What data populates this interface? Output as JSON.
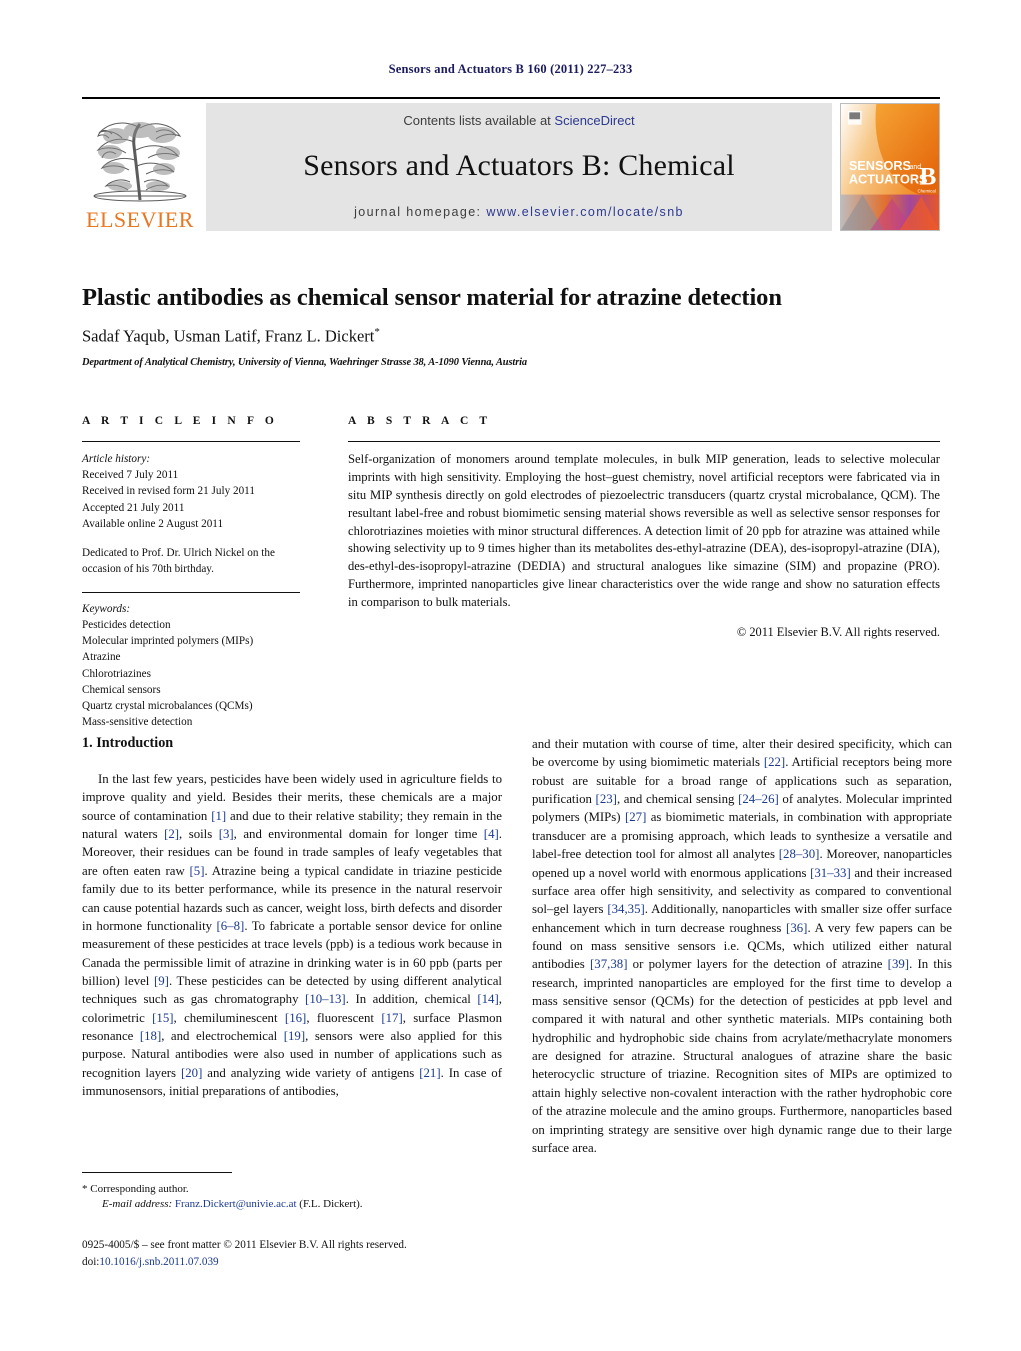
{
  "running_head": "Sensors and Actuators B 160 (2011) 227–233",
  "masthead": {
    "contents_prefix": "Contents lists available at ",
    "sciencedirect": "ScienceDirect",
    "journal_title": "Sensors and Actuators B: Chemical",
    "homepage_prefix": "journal homepage: ",
    "homepage_url": "www.elsevier.com/locate/snb",
    "publisher_wordmark": "ELSEVIER",
    "publisher_logo_icon": "elsevier-tree-icon",
    "cover": {
      "line1": "SENSORS",
      "line1_small": "and",
      "line2": "ACTUATORS",
      "letter": "B",
      "letter_sub": "Chemical"
    },
    "accent_orange": "#E87722",
    "link_blue": "#2b3990",
    "band_gray": "#e4e4e4"
  },
  "article": {
    "title": "Plastic antibodies as chemical sensor material for atrazine detection",
    "authors": "Sadaf Yaqub, Usman Latif, Franz L. Dickert",
    "corresponding_marker": "*",
    "affiliation": "Department of Analytical Chemistry, University of Vienna, Waehringer Strasse 38, A-1090 Vienna, Austria"
  },
  "article_info": {
    "heading": "A R T I C L E  I N F O",
    "history_label": "Article history:",
    "history": [
      "Received 7 July 2011",
      "Received in revised form 21 July 2011",
      "Accepted 21 July 2011",
      "Available online 2 August 2011"
    ],
    "dedication": "Dedicated to Prof. Dr. Ulrich Nickel on the occasion of his 70th birthday.",
    "keywords_label": "Keywords:",
    "keywords": [
      "Pesticides detection",
      "Molecular imprinted polymers (MIPs)",
      "Atrazine",
      "Chlorotriazines",
      "Chemical sensors",
      "Quartz crystal microbalances (QCMs)",
      "Mass-sensitive detection"
    ]
  },
  "abstract": {
    "heading": "A B S T R A C T",
    "text": "Self-organization of monomers around template molecules, in bulk MIP generation, leads to selective molecular imprints with high sensitivity. Employing the host–guest chemistry, novel artificial receptors were fabricated via in situ MIP synthesis directly on gold electrodes of piezoelectric transducers (quartz crystal microbalance, QCM). The resultant label-free and robust biomimetic sensing material shows reversible as well as selective sensor responses for chlorotriazines moieties with minor structural differences. A detection limit of 20 ppb for atrazine was attained while showing selectivity up to 9 times higher than its metabolites des-ethyl-atrazine (DEA), des-isopropyl-atrazine (DIA), des-ethyl-des-isopropyl-atrazine (DEDIA) and structural analogues like simazine (SIM) and propazine (PRO). Furthermore, imprinted nanoparticles give linear characteristics over the wide range and show no saturation effects in comparison to bulk materials.",
    "copyright": "© 2011 Elsevier B.V. All rights reserved."
  },
  "body": {
    "section_number_title": "1.  Introduction",
    "left_para_1": "In the last few years, pesticides have been widely used in agriculture fields to improve quality and yield. Besides their merits, these chemicals are a major source of contamination [1] and due to their relative stability; they remain in the natural waters [2], soils [3], and environmental domain for longer time [4]. Moreover, their residues can be found in trade samples of leafy vegetables that are often eaten raw [5]. Atrazine being a typical candidate in triazine pesticide family due to its better performance, while its presence in the natural reservoir can cause potential hazards such as cancer, weight loss, birth defects and disorder in hormone functionality [6–8]. To fabricate a portable sensor device for online measurement of these pesticides at trace levels (ppb) is a tedious work because in Canada the permissible limit of atrazine in drinking water is in 60 ppb (parts per billion) level [9]. These pesticides can be detected by using different analytical techniques such as gas chromatography [10–13]. In addition, chemical [14], colorimetric [15], chemiluminescent [16], fluorescent [17], surface Plasmon resonance [18], and electrochemical [19], sensors were also applied for this purpose. Natural antibodies were also used in number of applications such as recognition layers [20] and analyzing wide variety of antigens [21]. In case of immunosensors, initial preparations of antibodies,",
    "right_para_1": "and their mutation with course of time, alter their desired specificity, which can be overcome by using biomimetic materials [22]. Artificial receptors being more robust are suitable for a broad range of applications such as separation, purification [23], and chemical sensing [24–26] of analytes. Molecular imprinted polymers (MIPs) [27] as biomimetic materials, in combination with appropriate transducer are a promising approach, which leads to synthesize a versatile and label-free detection tool for almost all analytes [28–30]. Moreover, nanoparticles opened up a novel world with enormous applications [31–33] and their increased surface area offer high sensitivity, and selectivity as compared to conventional sol–gel layers [34,35]. Additionally, nanoparticles with smaller size offer surface enhancement which in turn decrease roughness [36]. A very few papers can be found on mass sensitive sensors i.e. QCMs, which utilized either natural antibodies [37,38] or polymer layers for the detection of atrazine [39]. In this research, imprinted nanoparticles are employed for the first time to develop a mass sensitive sensor (QCMs) for the detection of pesticides at ppb level and compared it with natural and other synthetic materials. MIPs containing both hydrophilic and hydrophobic side chains from acrylate/methacrylate monomers are designed for atrazine. Structural analogues of atrazine share the basic heterocyclic structure of triazine. Recognition sites of MIPs are optimized to attain highly selective non-covalent interaction with the rather hydrophobic core of the atrazine molecule and the amino groups. Furthermore, nanoparticles based on imprinting strategy are sensitive over high dynamic range due to their large surface area."
  },
  "footnote": {
    "corresponding": "* Corresponding author.",
    "email_label": "E-mail address:",
    "email": "Franz.Dickert@univie.ac.at",
    "email_suffix": "(F.L. Dickert).",
    "issn_line": "0925-4005/$ – see front matter © 2011 Elsevier B.V. All rights reserved.",
    "doi_label": "doi:",
    "doi_value": "10.1016/j.snb.2011.07.039"
  }
}
